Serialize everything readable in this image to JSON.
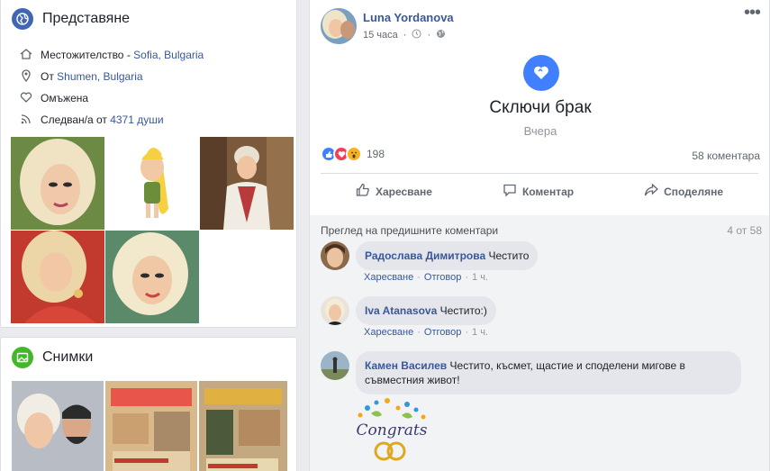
{
  "intro": {
    "title": "Представяне",
    "lives_label": "Местожителство - ",
    "lives_value": "Sofia, Bulgaria",
    "from_label": "От ",
    "from_value": "Shumen, Bulgaria",
    "status": "Омъжена",
    "followed_label": "Следван/а от ",
    "followed_value": "4371 души"
  },
  "photos": {
    "title": "Снимки"
  },
  "post": {
    "author": "Luna Yordanova",
    "time": "15 часа",
    "event_title": "Сключи брак",
    "event_date": "Вчера",
    "reaction_count": "198",
    "comment_count": "58 коментара",
    "like": "Харесване",
    "comment": "Коментар",
    "share": "Споделяне",
    "prev_comments": "Преглед на предишните коментари",
    "prev_count": "4 от 58"
  },
  "comments": [
    {
      "name": "Радослава Димитрова",
      "text": "Честито",
      "like": "Харесване",
      "reply": "Отговор",
      "time": "1 ч."
    },
    {
      "name": "Iva Atanasova",
      "text": "Честито:)",
      "like": "Харесване",
      "reply": "Отговор",
      "time": "1 ч."
    },
    {
      "name": "Камен Василев",
      "text": "Честито, късмет, щастие и споделени мигове в",
      "text2": "съвместния живот!"
    }
  ],
  "gif_text": "Congrats",
  "colors": {
    "accent": "#4080ff",
    "link": "#385898",
    "globe_icon_bg": "#4267b2",
    "photos_icon_bg": "#42b72a"
  },
  "icons": [
    "globe-icon",
    "house-icon",
    "pin-icon",
    "heart-icon",
    "rss-icon",
    "image-icon",
    "clock-icon",
    "globe-small-icon",
    "more-icon",
    "like-icon",
    "comment-icon",
    "share-icon"
  ]
}
